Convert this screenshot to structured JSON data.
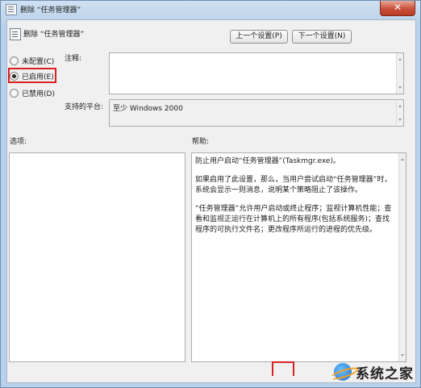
{
  "window": {
    "title": "删除 “任务管理器”",
    "close_label": "✕"
  },
  "policy": {
    "title": "删除 “任务管理器”"
  },
  "nav": {
    "prev_label": "上一个设置(P)",
    "next_label": "下一个设置(N)"
  },
  "state": {
    "options": [
      {
        "label": "未配置(C)",
        "checked": false
      },
      {
        "label": "已启用(E)",
        "checked": true
      },
      {
        "label": "已禁用(D)",
        "checked": false
      }
    ]
  },
  "labels": {
    "comment": "注释:",
    "supported_on": "支持的平台:",
    "options": "选项:",
    "help": "帮助:"
  },
  "fields": {
    "comment_value": "",
    "supported_on_value": "至少 Windows 2000"
  },
  "help_text": [
    "防止用户启动“任务管理器”(Taskmgr.exe)。",
    "如果启用了此设置，那么，当用户尝试启动“任务管理器”时，系统会显示一则消息，说明某个策略阻止了该操作。",
    "“任务管理器”允许用户启动或终止程序；监视计算机性能；查看和监视正运行在计算机上的所有程序(包括系统服务)；查找程序的可执行文件名；更改程序所运行的进程的优先级。"
  ],
  "watermark": {
    "text": "系统之家"
  },
  "colors": {
    "highlight": "#d82020",
    "titlebar": "#b9d1ea"
  }
}
